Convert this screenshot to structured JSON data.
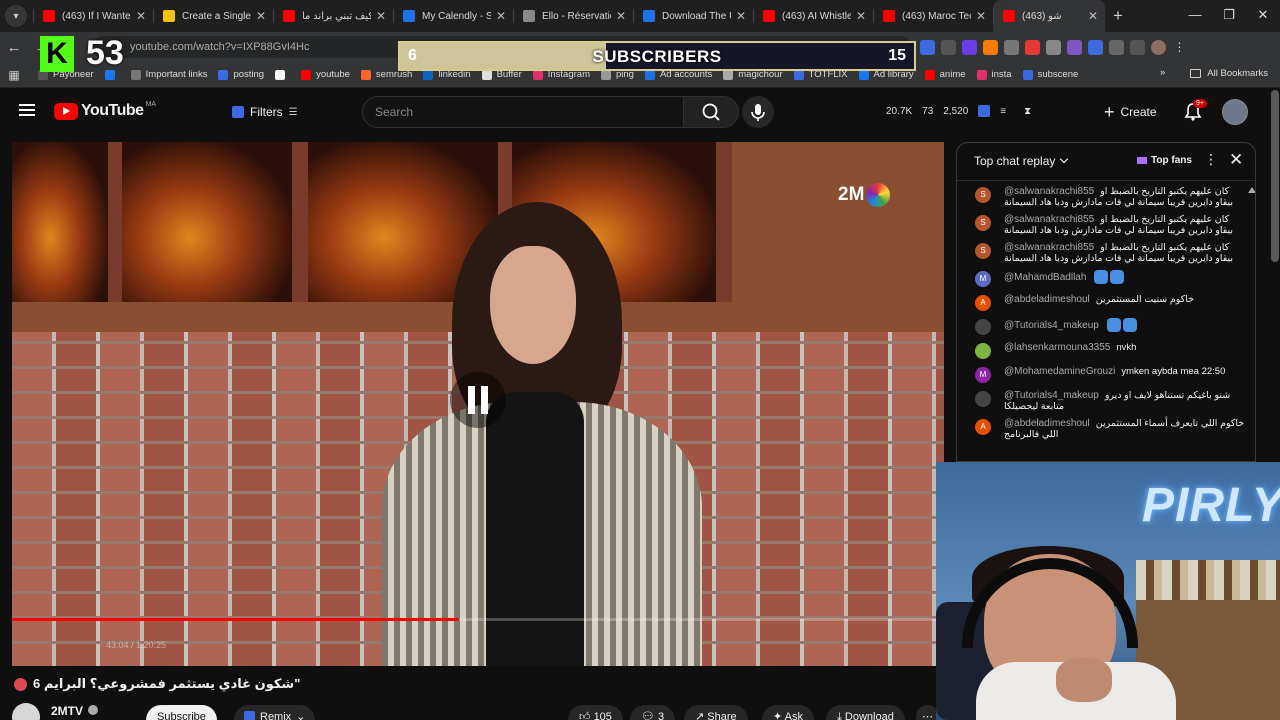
{
  "browser": {
    "tabs": [
      {
        "title": "(463) If I Wanted",
        "color": "#ff0000"
      },
      {
        "title": "Create a Single-",
        "color": "#f5c400"
      },
      {
        "title": "كيف تبني براند ما",
        "color": "#ff0000"
      },
      {
        "title": "My Calendly - Sc",
        "color": "#1a73e8"
      },
      {
        "title": "Ello - Réservation",
        "color": "#888888"
      },
      {
        "title": "Download The U",
        "color": "#1a73e8"
      },
      {
        "title": "(463) AI Whistleb",
        "color": "#ff0000"
      },
      {
        "title": "(463) Maroc Tech",
        "color": "#ff0000"
      },
      {
        "title": "(463) شو",
        "color": "#ff0000",
        "active": true
      }
    ],
    "new_tab": "+",
    "url": "youtube.com/watch?v=IXP88GvI4Hc",
    "window_controls": [
      "—",
      "❐",
      "✕"
    ],
    "bookmarks": [
      {
        "label": "Payoneer",
        "color": "#555555"
      },
      {
        "label": "",
        "color": "#1877f2"
      },
      {
        "label": "Important links",
        "color": "#777777"
      },
      {
        "label": "posting",
        "color": "#3e6ae1"
      },
      {
        "label": "",
        "color": "#ffffff"
      },
      {
        "label": "youtube",
        "color": "#ff0000"
      },
      {
        "label": "semrush",
        "color": "#ff642d"
      },
      {
        "label": "linkedin",
        "color": "#0a66c2"
      },
      {
        "label": "Buffer",
        "color": "#dddddd"
      },
      {
        "label": "Instagram",
        "color": "#e1306c"
      },
      {
        "label": "ping",
        "color": "#999999"
      },
      {
        "label": "Ad accounts",
        "color": "#1a73e8"
      },
      {
        "label": "magichour",
        "color": "#aaaaaa"
      },
      {
        "label": "TOTFLIX",
        "color": "#3e6ae1"
      },
      {
        "label": "Ad library",
        "color": "#1877f2"
      },
      {
        "label": "anime",
        "color": "#ff0000"
      },
      {
        "label": "insta",
        "color": "#e1306c"
      },
      {
        "label": "subscene",
        "color": "#3e6ae1"
      }
    ],
    "all_bookmarks": "All Bookmarks"
  },
  "overlay": {
    "kick_logo": "K",
    "kick_count": "53",
    "subs_label": "SUBSCRIBERS",
    "subs_current": "6",
    "subs_goal": "15",
    "subs_progress": 0.4
  },
  "youtube": {
    "logo": "YouTube",
    "country": "MA",
    "filters": "Filters",
    "search_placeholder": "Search",
    "stats": [
      "20.7K",
      "73",
      "2,520"
    ],
    "create": "Create",
    "notifications": "9+"
  },
  "video": {
    "channel_logo": "2M",
    "progress": 0.48,
    "time": "43:04 / 1:20:25",
    "title": "شكون غادي يستثمر فمشروعي؟ البرايم 6\"",
    "channel": "2MTV",
    "subscribe": "Subscribe",
    "remix": "Remix",
    "likes": "105",
    "comments": "3",
    "share": "Share",
    "ask": "Ask",
    "download": "Download"
  },
  "chat": {
    "title": "Top chat replay",
    "top_fans": "Top fans",
    "messages": [
      {
        "author": "@salwanakrachi855",
        "text": "كان عليهم يكتبو التاريخ بالضبط او بيقاو دايرين فريبا سيمانة لي فات مادازش ودبا هاد السيمانة",
        "initial": "S",
        "color": "#b5562c"
      },
      {
        "author": "@salwanakrachi855",
        "text": "كان عليهم يكتبو التاريخ بالضبط او بيقاو دايرين فريبا سيمانة لي فات مادازش ودبا هاد السيمانة",
        "initial": "S",
        "color": "#b5562c"
      },
      {
        "author": "@salwanakrachi855",
        "text": "كان عليهم يكتبو التاريخ بالضبط او بيقاو دايرين فريبا سيمانة لي فات مادازش ودبا هاد السيمانة",
        "initial": "S",
        "color": "#b5562c"
      },
      {
        "author": "@MahamdBadllah",
        "text": "",
        "initial": "M",
        "color": "#5c6bc0",
        "emoji": true
      },
      {
        "author": "@abdeladimeshoul",
        "text": "خاكوم ستيت المستثمرين",
        "initial": "A",
        "color": "#e65100"
      },
      {
        "author": "@Tutorials4_makeup",
        "text": "",
        "initial": "",
        "color": "#444444",
        "emoji": true
      },
      {
        "author": "@lahsenkarmouna3355",
        "text": "nvkh",
        "initial": "",
        "color": "#7cb342"
      },
      {
        "author": "@MohamedamineGrouzi",
        "text": "ymken aybda mea 22:50",
        "initial": "M",
        "color": "#8e24aa"
      },
      {
        "author": "@Tutorials4_makeup",
        "text": "شنو باغيكم تستناهو لايف او ديرو متابعة ليحصيلكا",
        "initial": "",
        "color": "#444444"
      },
      {
        "author": "@abdeladimeshoul",
        "text": "خاكوم اللي تايعرف أسماء المستثمرين اللي فالبرنامج",
        "initial": "A",
        "color": "#e65100"
      }
    ]
  },
  "webcam": {
    "neon_text": "PIRLY"
  }
}
